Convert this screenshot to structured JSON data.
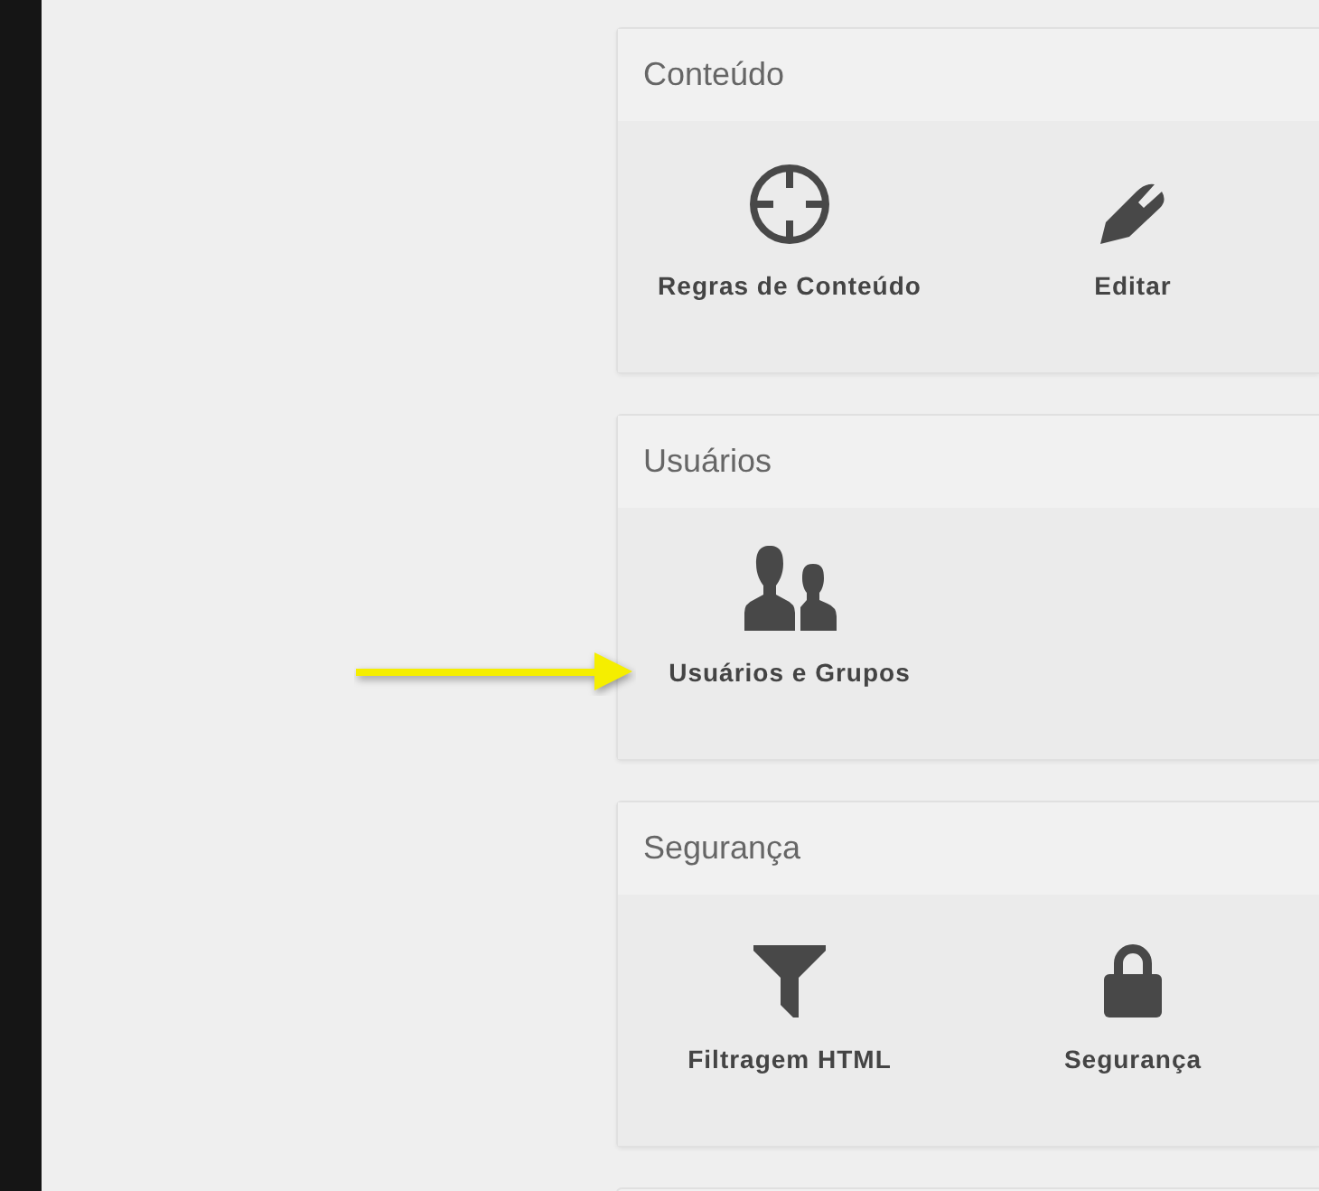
{
  "sections": [
    {
      "title": "Conteúdo",
      "items": [
        {
          "label": "Regras de Conteúdo"
        },
        {
          "label": "Editar"
        }
      ]
    },
    {
      "title": "Usuários",
      "items": [
        {
          "label": "Usuários e Grupos"
        }
      ]
    },
    {
      "title": "Segurança",
      "items": [
        {
          "label": "Filtragem HTML"
        },
        {
          "label": "Segurança"
        }
      ]
    }
  ]
}
